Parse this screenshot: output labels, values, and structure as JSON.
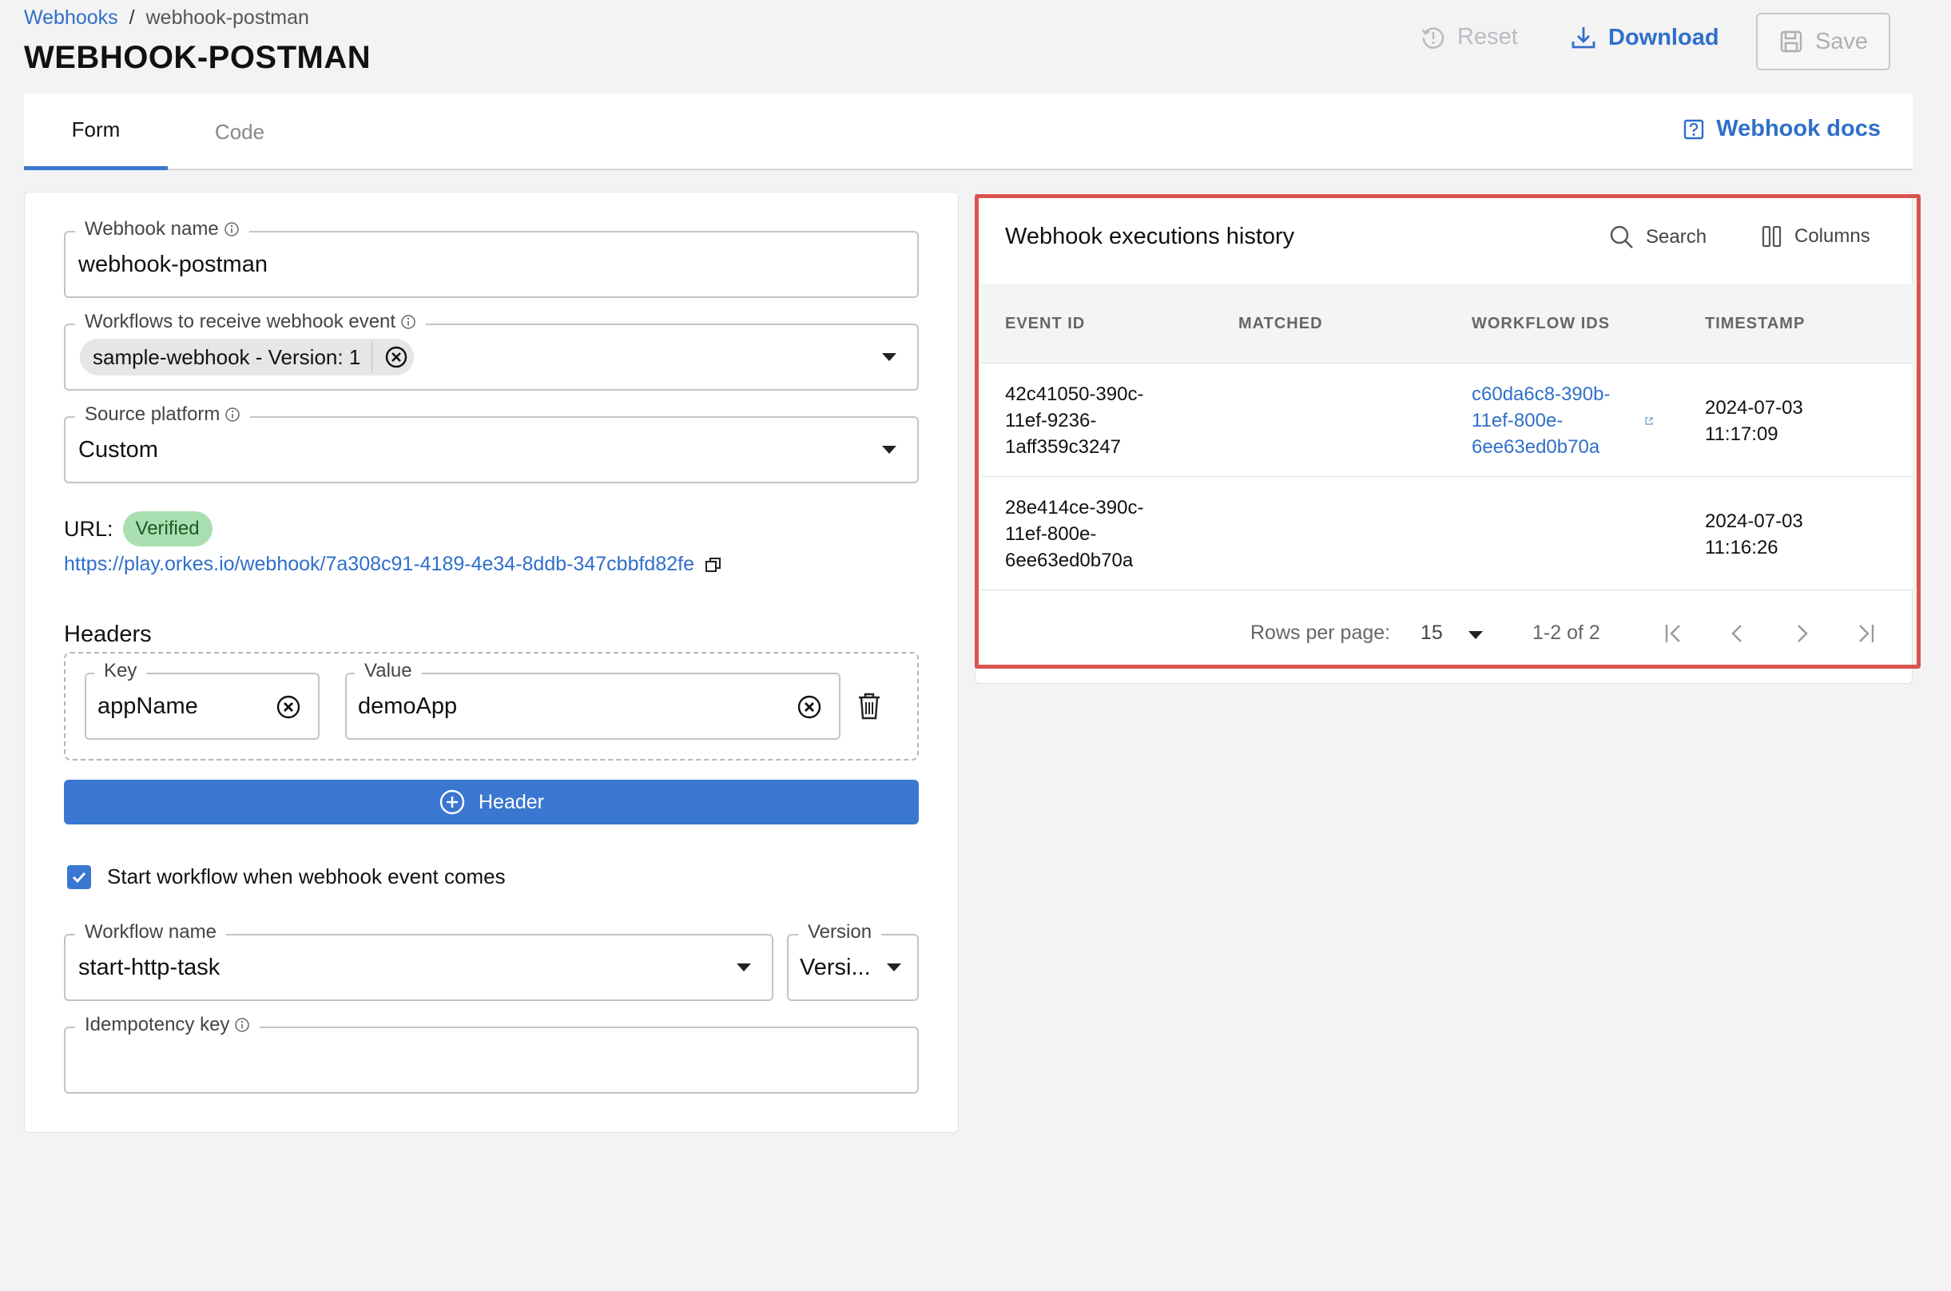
{
  "breadcrumb": {
    "parent": "Webhooks",
    "separator": "/",
    "current": "webhook-postman"
  },
  "page_title": "WEBHOOK-POSTMAN",
  "toolbar": {
    "reset_label": "Reset",
    "download_label": "Download",
    "save_label": "Save"
  },
  "tabs": [
    {
      "label": "Form",
      "active": true
    },
    {
      "label": "Code",
      "active": false
    }
  ],
  "docs_link": "Webhook docs",
  "form": {
    "webhook_name": {
      "label": "Webhook name",
      "value": "webhook-postman"
    },
    "workflows": {
      "label": "Workflows to receive webhook event",
      "chip": "sample-webhook - Version: 1"
    },
    "source_platform": {
      "label": "Source platform",
      "value": "Custom"
    },
    "url": {
      "label": "URL:",
      "status": "Verified",
      "value": "https://play.orkes.io/webhook/7a308c91-4189-4e34-8ddb-347cbbfd82fe"
    },
    "headers": {
      "title": "Headers",
      "key_label": "Key",
      "key_value": "appName",
      "value_label": "Value",
      "value_value": "demoApp",
      "add_label": "Header"
    },
    "start_workflow": {
      "label": "Start workflow when webhook event comes",
      "checked": true
    },
    "workflow_name": {
      "label": "Workflow name",
      "value": "start-http-task"
    },
    "version": {
      "label": "Version",
      "value": "Versi..."
    },
    "idempotency": {
      "label": "Idempotency key",
      "value": ""
    }
  },
  "history": {
    "title": "Webhook executions history",
    "search_label": "Search",
    "columns_label": "Columns",
    "headers": [
      "EVENT ID",
      "MATCHED",
      "WORKFLOW IDS",
      "TIMESTAMP"
    ],
    "rows": [
      {
        "event_id": [
          "42c41050-390c-",
          "11ef-9236-",
          "1aff359c3247"
        ],
        "matched": "",
        "workflow_ids": [
          "c60da6c8-390b-",
          "11ef-800e-",
          "6ee63ed0b70a"
        ],
        "timestamp": [
          "2024-07-03",
          "11:17:09"
        ]
      },
      {
        "event_id": [
          "28e414ce-390c-",
          "11ef-800e-",
          "6ee63ed0b70a"
        ],
        "matched": "",
        "workflow_ids": [],
        "timestamp": [
          "2024-07-03",
          "11:16:26"
        ]
      }
    ],
    "pagination": {
      "rows_per_page_label": "Rows per page:",
      "rows_per_page": "15",
      "range": "1-2 of 2"
    }
  },
  "colors": {
    "accent": "#3a77d0",
    "link": "#2f6fca",
    "verified_bg": "#a9dfb0",
    "highlight": "#d9534f"
  }
}
